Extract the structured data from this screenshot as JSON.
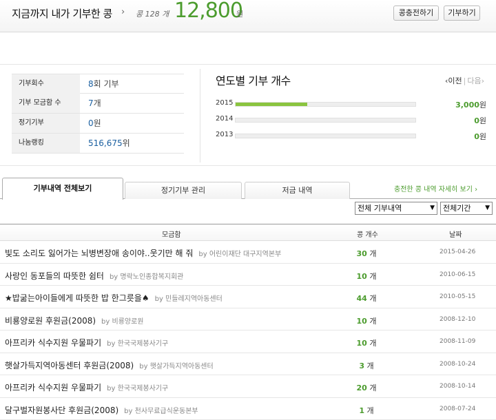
{
  "header": {
    "title": "지금까지 내가 기부한 콩",
    "chevron": "›",
    "count_label": "콩 128 개",
    "amount": "12,800",
    "unit": "원",
    "charge_button": "콩충전하기",
    "donate_button": "기부하기"
  },
  "stats": [
    {
      "key": "기부회수",
      "num": "8",
      "suffix": "회 기부"
    },
    {
      "key": "기부 모금함 수",
      "num": "7",
      "suffix": "개"
    },
    {
      "key": "정기기부",
      "num": "0",
      "suffix": "원"
    },
    {
      "key": "나눔랭킹",
      "num": "516,675",
      "suffix": "위"
    }
  ],
  "yearly": {
    "title": "연도별 기부 개수",
    "prev": "‹이전",
    "sep": "|",
    "next": "다음›",
    "rows": [
      {
        "year": "2015",
        "value": "3,000",
        "unit": "원",
        "fill": 0.4
      },
      {
        "year": "2014",
        "value": "0",
        "unit": "원",
        "fill": 0
      },
      {
        "year": "2013",
        "value": "0",
        "unit": "원",
        "fill": 0
      }
    ]
  },
  "tabs": {
    "all": "기부내역 전체보기",
    "regular": "정기기부 관리",
    "deposit": "저금 내역",
    "detail_link": "충전한 콩 내역 자세히 보기 ›"
  },
  "filters": {
    "type": "전체 기부내역",
    "period": "전체기간",
    "arrow": "▼"
  },
  "table": {
    "headers": {
      "name": "모금함",
      "count": "콩 개수",
      "date": "날짜"
    },
    "rows": [
      {
        "title": "빛도 소리도 잃어가는 뇌병변장애 송이야..웃기만 해 줘",
        "by": "by 어린이재단 대구지역본부",
        "count": "30",
        "unit": "개",
        "date": "2015-04-26"
      },
      {
        "title": "사랑인 동포들의 따뜻한 쉼터",
        "by": "by 명락노인종합복지회관",
        "count": "10",
        "unit": "개",
        "date": "2010-06-15"
      },
      {
        "title": "★밥굶는아이들에게 따뜻한 밥 한그릇을♠",
        "by": "by 민들레지역아동센터",
        "count": "44",
        "unit": "개",
        "date": "2010-05-15"
      },
      {
        "title": "비룡양로원 후원금(2008)",
        "by": "by 비룡양로원",
        "count": "10",
        "unit": "개",
        "date": "2008-12-10"
      },
      {
        "title": "아프리카 식수지원 우물파기",
        "by": "by 한국국제봉사기구",
        "count": "10",
        "unit": "개",
        "date": "2008-11-09"
      },
      {
        "title": "햇살가득지역아동센터 후원금(2008)",
        "by": "by 햇살가득지역아동센터",
        "count": "3",
        "unit": "개",
        "date": "2008-10-24"
      },
      {
        "title": "아프리카 식수지원 우물파기",
        "by": "by 한국국제봉사기구",
        "count": "20",
        "unit": "개",
        "date": "2008-10-14"
      },
      {
        "title": "달구벌자원봉사단 후원금(2008)",
        "by": "by 천사무료급식운동본부",
        "count": "1",
        "unit": "개",
        "date": "2008-07-24"
      }
    ]
  }
}
